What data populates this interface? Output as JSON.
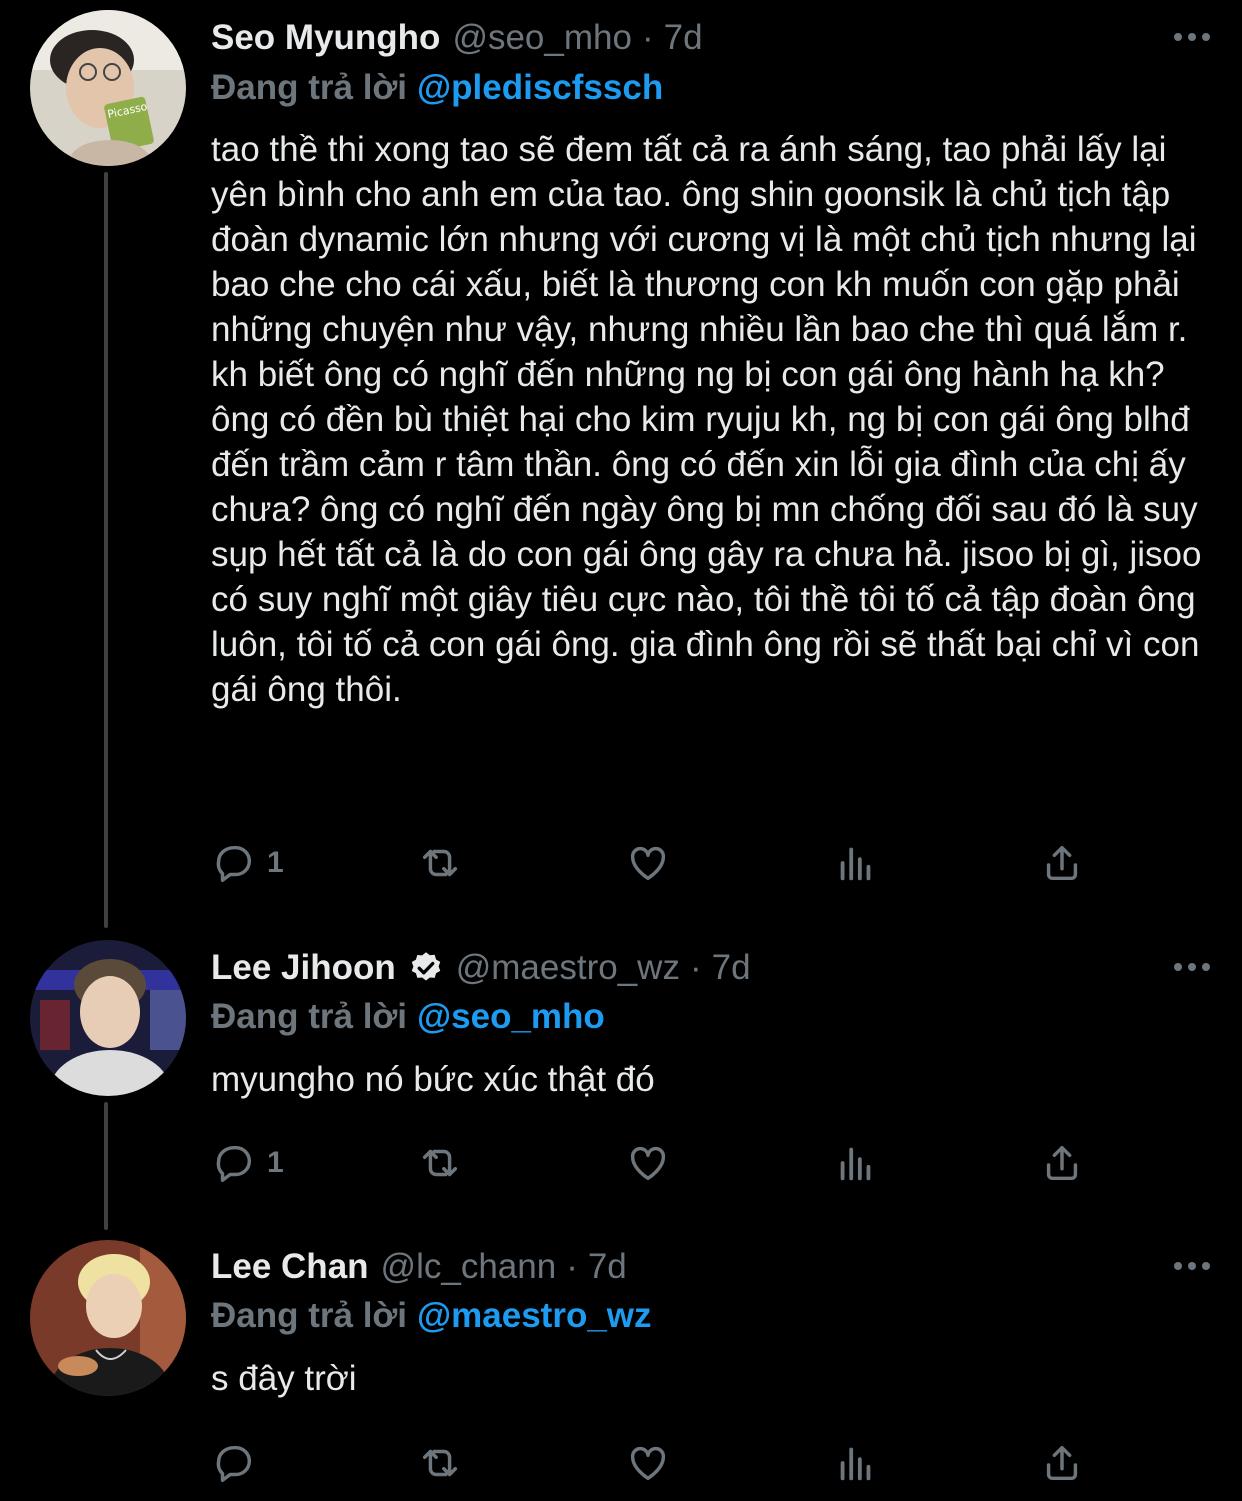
{
  "colors": {
    "background": "#000000",
    "text": "#e7e9ea",
    "muted": "#6e767d",
    "link": "#1d9bf0",
    "thread_line": "#3e4144"
  },
  "tweets": [
    {
      "name": "Seo Myungho",
      "handle": "@seo_mho",
      "dot": "·",
      "time": "7d",
      "verified": false,
      "replying_label": "Đang trả lời",
      "replying_to": "@pledisсfssch",
      "text": "tao thề thi xong tao sẽ đem tất cả ra ánh sáng, tao phải lấy lại yên bình cho anh em của tao. ông shin goonsik là chủ tịch tập đoàn dynamic lớn nhưng với cương vị là một chủ tịch nhưng lại bao che cho cái xấu, biết là thương con kh muốn con gặp phải những chuyện như vậy, nhưng nhiều lần bao che thì quá lắm r. kh biết ông có nghĩ đến những ng bị con gái ông hành hạ kh? ông có đền bù thiệt hại cho kim ryuju kh, ng bị con gái ông blhđ đến trầm cảm r tâm thần. ông có đến xin lỗi gia đình của chị ấy chưa? ông có nghĩ đến ngày ông bị mn chống đối sau đó là suy sụp hết tất cả là do con gái ông gây ra chưa hả. jisoo bị gì, jisoo có suy nghĩ một giây tiêu cực nào, tôi thề tôi tố cả tập đoàn ông luôn, tôi tố cả con gái ông. gia đình ông rồi sẽ thất bại chỉ vì con gái ông thôi.",
      "reply_count": "1",
      "avatar_icon": "avatar-photo"
    },
    {
      "name": "Lee Jihoon",
      "handle": "@maestro_wz",
      "dot": "·",
      "time": "7d",
      "verified": true,
      "replying_label": "Đang trả lời",
      "replying_to": "@seo_mho",
      "text": "myungho nó bức xúc thật đó",
      "reply_count": "1",
      "avatar_icon": "avatar-photo"
    },
    {
      "name": "Lee Chan",
      "handle": "@lc_chann",
      "dot": "·",
      "time": "7d",
      "verified": false,
      "replying_label": "Đang trả lời",
      "replying_to": "@maestro_wz",
      "text": "s đây trời",
      "reply_count": "",
      "avatar_icon": "avatar-photo"
    }
  ],
  "icons": [
    "reply-icon",
    "retweet-icon",
    "like-icon",
    "analytics-icon",
    "share-icon",
    "more-icon",
    "verified-badge-icon"
  ]
}
